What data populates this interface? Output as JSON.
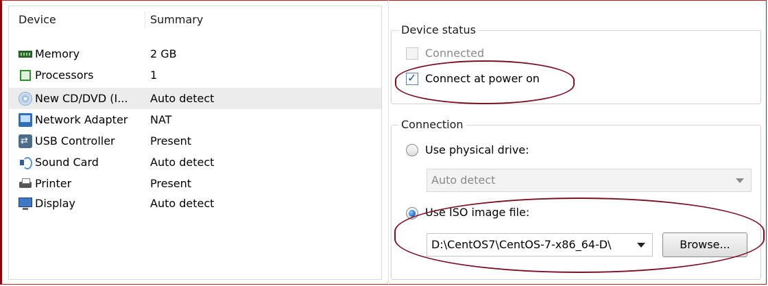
{
  "device_list": {
    "headers": {
      "device": "Device",
      "summary": "Summary"
    },
    "rows": [
      {
        "name": "Memory",
        "summary": "2 GB",
        "icon": "memory-icon"
      },
      {
        "name": "Processors",
        "summary": "1",
        "icon": "processor-icon"
      },
      {
        "name": "New CD/DVD (I...",
        "summary": "Auto detect",
        "icon": "cd-dvd-icon",
        "selected": true
      },
      {
        "name": "Network Adapter",
        "summary": "NAT",
        "icon": "network-adapter-icon"
      },
      {
        "name": "USB Controller",
        "summary": "Present",
        "icon": "usb-controller-icon"
      },
      {
        "name": "Sound Card",
        "summary": "Auto detect",
        "icon": "sound-card-icon"
      },
      {
        "name": "Printer",
        "summary": "Present",
        "icon": "printer-icon"
      },
      {
        "name": "Display",
        "summary": "Auto detect",
        "icon": "display-icon"
      }
    ]
  },
  "device_status": {
    "title": "Device status",
    "connected_label": "Connected",
    "connected_checked": false,
    "connected_enabled": false,
    "connect_power_on_label": "Connect at power on",
    "connect_power_on_checked": true
  },
  "connection": {
    "title": "Connection",
    "physical_label": "Use physical drive:",
    "physical_selected": false,
    "physical_value": "Auto detect",
    "iso_label": "Use ISO image file:",
    "iso_selected": true,
    "iso_path": "D:\\CentOS7\\CentOS-7-x86_64-D\\",
    "browse_label": "Browse..."
  },
  "colors": {
    "annotation": "#7a1024",
    "frame": "#c01818",
    "selected_row": "#ececec"
  }
}
